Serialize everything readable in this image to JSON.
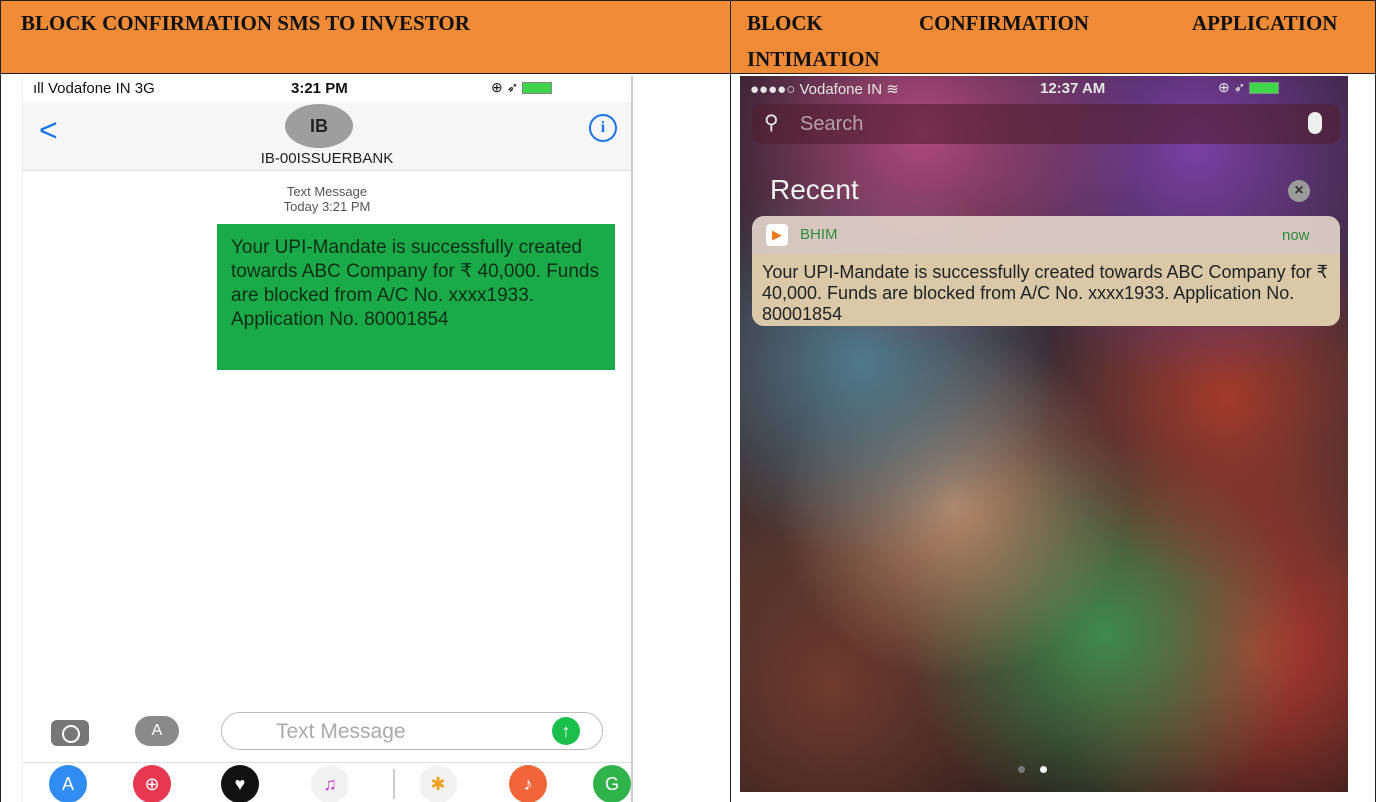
{
  "headers": {
    "left": "BLOCK CONFIRMATION SMS TO INVESTOR",
    "right_words": [
      "BLOCK",
      "CONFIRMATION",
      "APPLICATION",
      "INTIMATION"
    ]
  },
  "left_phone": {
    "status": {
      "carrier": "ıll Vodafone IN  3G",
      "time": "3:21 PM",
      "icons": "⊕ ➶"
    },
    "header": {
      "back": "<",
      "avatar": "IB",
      "contact": "IB-00ISSUERBANK",
      "info": "i"
    },
    "timestamp": {
      "line1": "Text Message",
      "line2": "Today 3:21 PM"
    },
    "message": "Your UPI-Mandate is successfully created towards ABC Company for ₹ 40,000. Funds are blocked from A/C No. xxxx1933. Application No. 80001854",
    "composer": {
      "placeholder": "Text Message",
      "send": "↑",
      "appstore": "A"
    },
    "apps": [
      {
        "name": "app-store",
        "glyph": "A",
        "color": "#2f8cf0"
      },
      {
        "name": "web-search",
        "glyph": "⊕",
        "color": "#e8384f"
      },
      {
        "name": "digital-touch",
        "glyph": "♥",
        "color": "#111111"
      },
      {
        "name": "music",
        "glyph": "♫",
        "color": "#f2f2f2"
      },
      {
        "name": "photos",
        "glyph": "✱",
        "color": "#f2f2f2"
      },
      {
        "name": "garageband",
        "glyph": "♪",
        "color": "#f0663a"
      },
      {
        "name": "maps",
        "glyph": "G",
        "color": "#2fb34a"
      }
    ],
    "accent": "#1aaa4a"
  },
  "right_phone": {
    "status": {
      "carrier": "●●●●○ Vodafone IN ≋",
      "time": "12:37 AM",
      "icons": "⊕ ➶"
    },
    "search": {
      "placeholder": "Search"
    },
    "recent_label": "Recent",
    "notification": {
      "app": "BHIM",
      "time": "now",
      "body": "Your UPI-Mandate is successfully created towards ABC Company for ₹ 40,000. Funds are blocked from A/C No. xxxx1933. Application No. 80001854"
    }
  },
  "colors": {
    "header_bg": "#ef8a36"
  }
}
